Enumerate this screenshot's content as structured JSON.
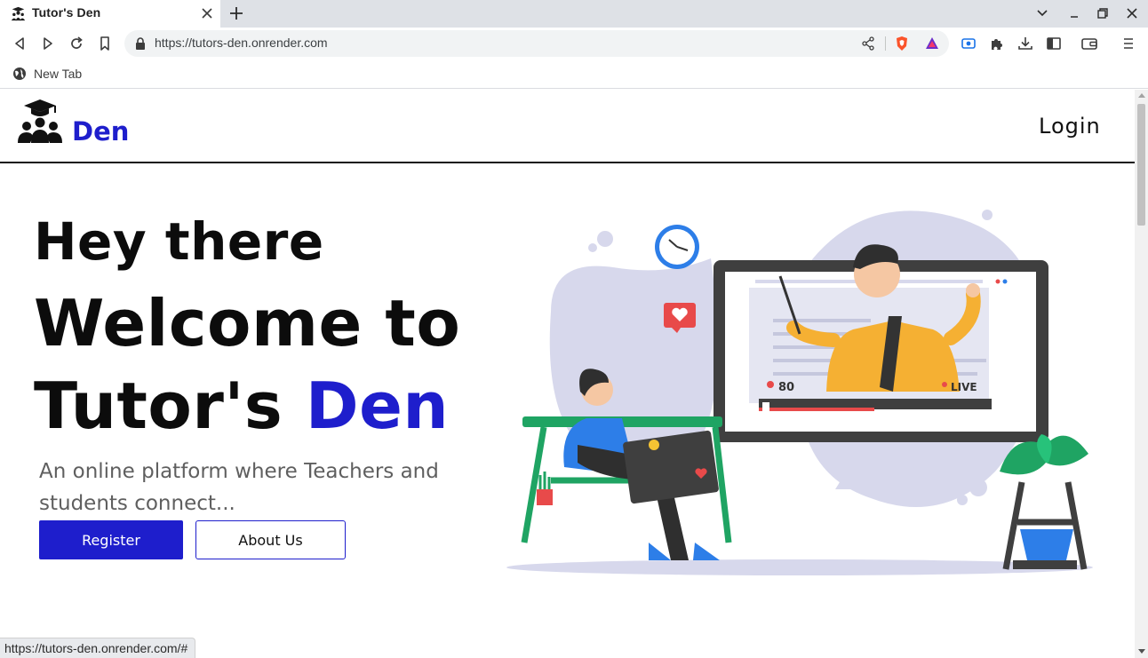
{
  "browser": {
    "tab_title": "Tutor's Den",
    "url": "https://tutors-den.onrender.com",
    "bookmark_label": "New Tab",
    "status_url": "https://tutors-den.onrender.com/#"
  },
  "site": {
    "logo_text": "Den",
    "login_label": "Login",
    "hero_line1": "Hey there",
    "hero_line2": "Welcome to",
    "hero_line3_prefix": "Tutor's ",
    "hero_line3_accent": "Den",
    "subtitle": "An online platform where Teachers and students connect...",
    "register_label": "Register",
    "about_label": "About Us",
    "illustration": {
      "viewer_count": "80",
      "live_label": "LIVE"
    }
  },
  "colors": {
    "brand": "#1e1ecc",
    "heading": "#0c0c0c",
    "subtitle": "#5f5f5f"
  }
}
